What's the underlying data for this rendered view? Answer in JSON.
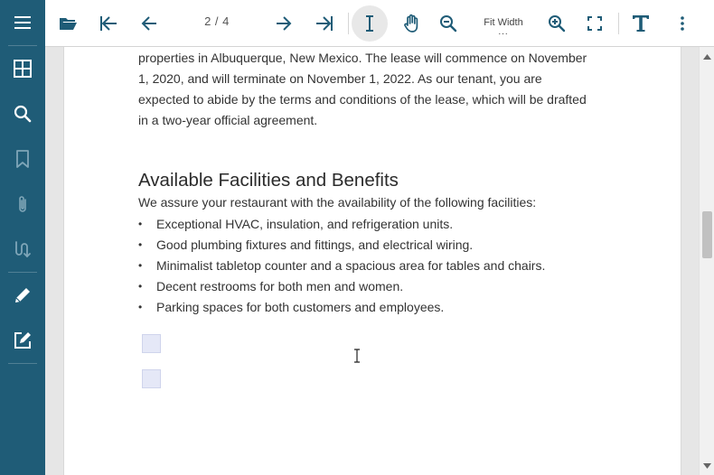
{
  "toolbar": {
    "page_indicator": "2 / 4",
    "zoom_mode": "Fit Width",
    "zoom_more": "...",
    "icons": [
      "folder-open-icon",
      "first-page-icon",
      "previous-page-icon",
      "next-page-icon",
      "last-page-icon",
      "text-select-icon",
      "pan-hand-icon",
      "zoom-out-icon",
      "zoom-in-icon",
      "fullscreen-icon",
      "text-annotation-icon",
      "more-vertical-icon"
    ]
  },
  "sidebar": {
    "icons": [
      "menu-icon",
      "thumbnails-icon",
      "search-icon",
      "bookmark-icon",
      "attachment-icon",
      "signature-icon",
      "pen-icon",
      "edit-form-icon"
    ]
  },
  "document": {
    "paragraph": "properties in Albuquerque, New Mexico. The lease will commence on November 1, 2020, and will terminate on November 1, 2022. As our tenant, you are expected to abide by the terms and conditions of the lease, which will be drafted in a two-year official agreement.",
    "heading": "Available Facilities and Benefits",
    "intro": "We assure your restaurant with the availability of the following facilities:",
    "bullets": [
      "Exceptional HVAC, insulation, and refrigeration units.",
      "Good plumbing fixtures and fittings, and electrical wiring.",
      "Minimalist tabletop counter and a spacious area for tables and chairs.",
      "Decent restrooms for both men and women.",
      "Parking spaces for both customers and employees."
    ],
    "bullet_char": "•"
  },
  "colors": {
    "sidebar_bg": "#1f5c77",
    "accent": "#1f5c77",
    "form_field": "#e5e8f7"
  }
}
